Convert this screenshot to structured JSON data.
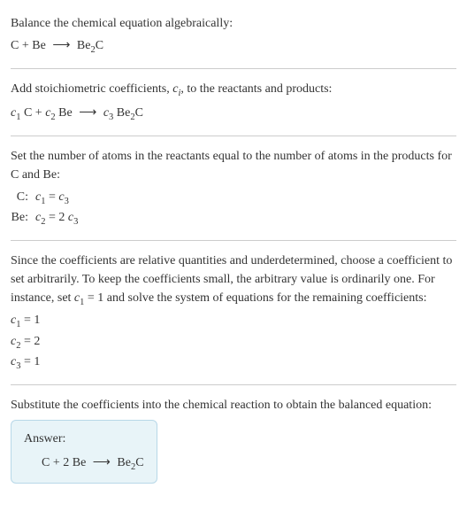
{
  "section1": {
    "intro": "Balance the chemical equation algebraically:",
    "eq_left1": "C",
    "eq_plus1": " + ",
    "eq_left2": "Be",
    "eq_arrow": "⟶",
    "eq_right": "Be",
    "eq_right_sub": "2",
    "eq_right2": "C"
  },
  "section2": {
    "intro_a": "Add stoichiometric coefficients, ",
    "intro_ci": "c",
    "intro_ci_sub": "i",
    "intro_b": ", to the reactants and products:",
    "c1": "c",
    "c1_sub": "1",
    "t1": " C + ",
    "c2": "c",
    "c2_sub": "2",
    "t2": " Be ",
    "arrow": "⟶",
    "c3": " c",
    "c3_sub": "3",
    "t3": " Be",
    "t3_sub": "2",
    "t4": "C"
  },
  "section3": {
    "intro": "Set the number of atoms in the reactants equal to the number of atoms in the products for C and Be:",
    "row1_label": "C:",
    "row1_c1": "c",
    "row1_c1_sub": "1",
    "row1_eq": " = ",
    "row1_c3": "c",
    "row1_c3_sub": "3",
    "row2_label": "Be:",
    "row2_c2": "c",
    "row2_c2_sub": "2",
    "row2_eq": " = 2 ",
    "row2_c3": "c",
    "row2_c3_sub": "3"
  },
  "section4": {
    "intro_a": "Since the coefficients are relative quantities and underdetermined, choose a coefficient to set arbitrarily. To keep the coefficients small, the arbitrary value is ordinarily one. For instance, set ",
    "c1": "c",
    "c1_sub": "1",
    "intro_b": " = 1 and solve the system of equations for the remaining coefficients:",
    "line1_c": "c",
    "line1_sub": "1",
    "line1_val": " = 1",
    "line2_c": "c",
    "line2_sub": "2",
    "line2_val": " = 2",
    "line3_c": "c",
    "line3_sub": "3",
    "line3_val": " = 1"
  },
  "section5": {
    "intro": "Substitute the coefficients into the chemical reaction to obtain the balanced equation:",
    "answer_label": "Answer:",
    "eq_a": "C + 2 Be ",
    "eq_arrow": "⟶",
    "eq_b": " Be",
    "eq_b_sub": "2",
    "eq_c": "C"
  }
}
